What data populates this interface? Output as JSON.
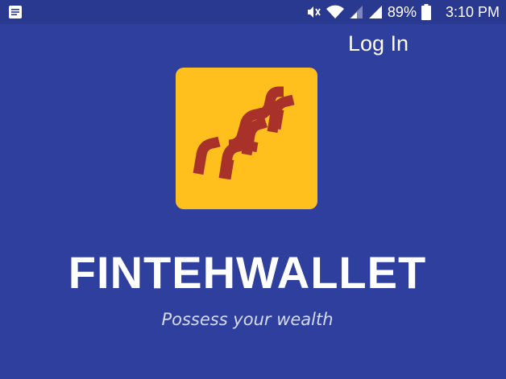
{
  "status_bar": {
    "battery": "89%",
    "time": "3:10 PM",
    "icons": [
      "notification-icon",
      "mute-icon",
      "wifi-icon",
      "signal-icon",
      "signal-icon",
      "battery-icon"
    ]
  },
  "header": {
    "login_label": "Log In"
  },
  "brand": {
    "name": "FINTEHWALLET",
    "tagline": "Possess your wealth",
    "logo_icon": "fintehwallet-logo-icon"
  },
  "colors": {
    "background": "#2f3f9e",
    "logo_tile": "#ffc01e",
    "logo_mark": "#a8322a",
    "text": "#ffffff"
  }
}
